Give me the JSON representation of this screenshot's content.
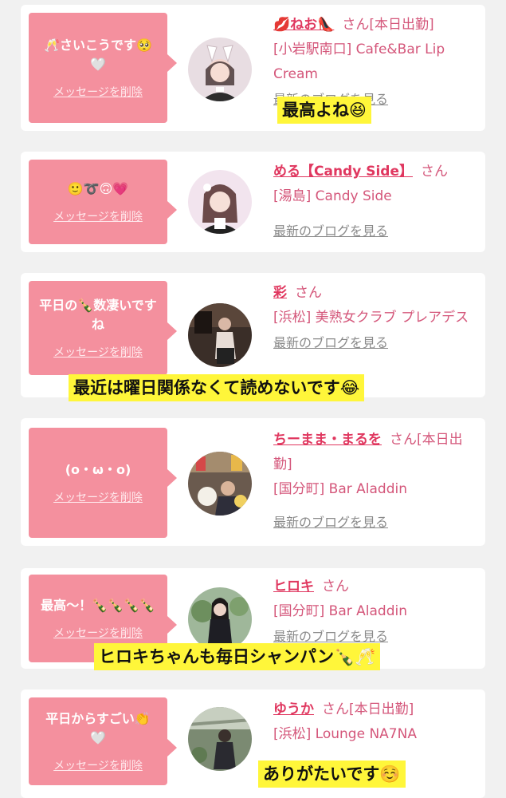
{
  "delete_label": "メッセージを削除",
  "blog_label": "最新のブログを見る",
  "san_label": "さん",
  "items": [
    {
      "bubble": "🥂さいこうです🥺🤍",
      "name": "💋ねお👠",
      "status": "[本日出勤]",
      "shop_line1": "[小岩駅南口] Cafe&Bar Lip",
      "shop_line2": "Cream",
      "overlay": "最高よね😆"
    },
    {
      "bubble": "🙂➰🙃💗",
      "name": "める【Candy Side】",
      "shop": "[湯島] Candy Side"
    },
    {
      "bubble": "平日の🍾数凄いですね",
      "name": "彩",
      "shop": "[浜松] 美熟女クラブ プレアデス",
      "overlay": "最近は曜日関係なくて読めないです😂"
    },
    {
      "bubble": "(o・ω・o)",
      "name": "ちーまま・まるを",
      "status": "[本日出勤]",
      "shop": "[国分町] Bar Aladdin"
    },
    {
      "bubble": "最高〜！🍾🍾🍾🍾",
      "name": "ヒロキ",
      "shop": "[国分町] Bar Aladdin",
      "overlay": "ヒロキちゃんも毎日シャンパン🍾🥂"
    },
    {
      "bubble": "平日からすごい👏🤍",
      "name": "ゆうか",
      "status": "[本日出勤]",
      "shop": "[浜松] Lounge NA7NA",
      "overlay": "ありがたいです☺️"
    }
  ],
  "colors": {
    "bubble": "#f4909e",
    "name": "#e0375f",
    "highlight": "#fff63a",
    "background": "#f1f1f1"
  }
}
